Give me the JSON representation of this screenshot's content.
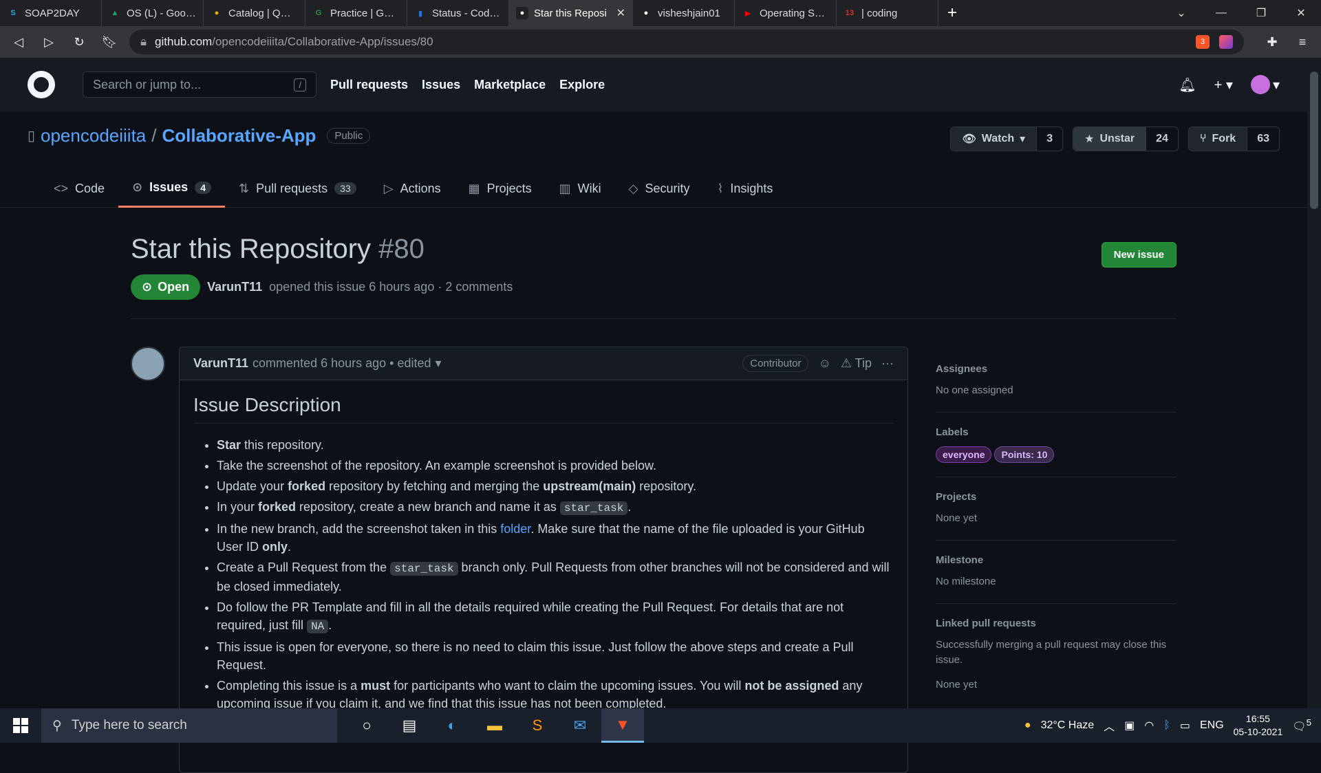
{
  "browser": {
    "tabs": [
      {
        "title": "SOAP2DAY",
        "fav": "S",
        "color": "#2ca7e0"
      },
      {
        "title": "OS (L) - Google Driv",
        "fav": "▲",
        "color": "#1fa463"
      },
      {
        "title": "Catalog | Qwiklabs",
        "fav": "●",
        "color": "#f4b400"
      },
      {
        "title": "Practice | GeeksforG",
        "fav": "G",
        "color": "#2f8d46"
      },
      {
        "title": "Status - Codeforces",
        "fav": "▮",
        "color": "#1a73e8"
      },
      {
        "title": "Star this Reposi",
        "fav": "●",
        "color": "#ffffff",
        "active": true
      },
      {
        "title": "visheshjain01",
        "fav": "●",
        "color": "#ffffff"
      },
      {
        "title": "Operating Systems",
        "fav": "▶",
        "color": "#ff0000"
      },
      {
        "title": "| coding",
        "fav": "13",
        "color": "#d93025"
      }
    ],
    "url_host": "github.com",
    "url_path": "/opencodeiiita/Collaborative-App/issues/80",
    "brave_shield_count": "3"
  },
  "gh": {
    "search_placeholder": "Search or jump to...",
    "slash_hint": "/",
    "nav": [
      "Pull requests",
      "Issues",
      "Marketplace",
      "Explore"
    ]
  },
  "repo": {
    "owner": "opencodeiiita",
    "separator": "/",
    "name": "Collaborative-App",
    "visibility": "Public",
    "watch_label": "Watch",
    "watch_count": "3",
    "unstar_label": "Unstar",
    "star_count": "24",
    "fork_label": "Fork",
    "fork_count": "63",
    "tabs": [
      {
        "label": "Code",
        "icon": "<>"
      },
      {
        "label": "Issues",
        "icon": "⊙",
        "count": "4",
        "selected": true
      },
      {
        "label": "Pull requests",
        "icon": "⇅",
        "count": "33"
      },
      {
        "label": "Actions",
        "icon": "▷"
      },
      {
        "label": "Projects",
        "icon": "▦"
      },
      {
        "label": "Wiki",
        "icon": "▥"
      },
      {
        "label": "Security",
        "icon": "◇"
      },
      {
        "label": "Insights",
        "icon": "⌇"
      }
    ]
  },
  "issue": {
    "title": "Star this Repository",
    "number": "#80",
    "new_issue_label": "New issue",
    "status": "Open",
    "author": "VarunT11",
    "meta_text": "opened this issue 6 hours ago · 2 comments"
  },
  "comment": {
    "author": "VarunT11",
    "meta": "commented 6 hours ago • edited",
    "badge": "Contributor",
    "tip_label": "Tip",
    "heading": "Issue Description",
    "items": [
      [
        {
          "b": "Star"
        },
        {
          "t": " this repository."
        }
      ],
      [
        {
          "t": "Take the screenshot of the repository. An example screenshot is provided below."
        }
      ],
      [
        {
          "t": "Update your "
        },
        {
          "b": "forked"
        },
        {
          "t": " repository by fetching and merging the "
        },
        {
          "b": "upstream(main)"
        },
        {
          "t": " repository."
        }
      ],
      [
        {
          "t": "In your "
        },
        {
          "b": "forked"
        },
        {
          "t": " repository, create a new branch and name it as "
        },
        {
          "c": "star_task"
        },
        {
          "t": "."
        }
      ],
      [
        {
          "t": "In the new branch, add the screenshot taken in this "
        },
        {
          "a": "folder"
        },
        {
          "t": ". Make sure that the name of the file uploaded is your GitHub User ID "
        },
        {
          "b": "only"
        },
        {
          "t": "."
        }
      ],
      [
        {
          "t": "Create a Pull Request from the "
        },
        {
          "c": "star_task"
        },
        {
          "t": " branch only. Pull Requests from other branches will not be considered and will be closed immediately."
        }
      ],
      [
        {
          "t": "Do follow the PR Template and fill in all the details required while creating the Pull Request. For details that are not required, just fill "
        },
        {
          "c": "NA"
        },
        {
          "t": "."
        }
      ],
      [
        {
          "t": "This issue is open for everyone, so there is no need to claim this issue. Just follow the above steps and create a Pull Request."
        }
      ],
      [
        {
          "t": "Completing this issue is a "
        },
        {
          "b": "must"
        },
        {
          "t": " for participants who want to claim the upcoming issues. You will "
        },
        {
          "b": "not be assigned"
        },
        {
          "t": " any upcoming issue if you claim it, and we find that this issue has not been completed."
        }
      ]
    ]
  },
  "sidebar": {
    "assignees_title": "Assignees",
    "assignees_value": "No one assigned",
    "labels_title": "Labels",
    "labels": [
      {
        "text": "everyone",
        "bg": "#3a1d4a",
        "fg": "#e2b5ff",
        "border": "#7b3fa8"
      },
      {
        "text": "Points: 10",
        "bg": "#3b2a4d",
        "fg": "#d6b8f5",
        "border": "#6e4a9a"
      }
    ],
    "projects_title": "Projects",
    "projects_value": "None yet",
    "milestone_title": "Milestone",
    "milestone_value": "No milestone",
    "linked_title": "Linked pull requests",
    "linked_desc": "Successfully merging a pull request may close this issue.",
    "linked_value": "None yet"
  },
  "taskbar": {
    "search_placeholder": "Type here to search",
    "weather": "32°C  Haze",
    "lang": "ENG",
    "time": "16:55",
    "date": "05-10-2021",
    "notif_count": "5"
  }
}
